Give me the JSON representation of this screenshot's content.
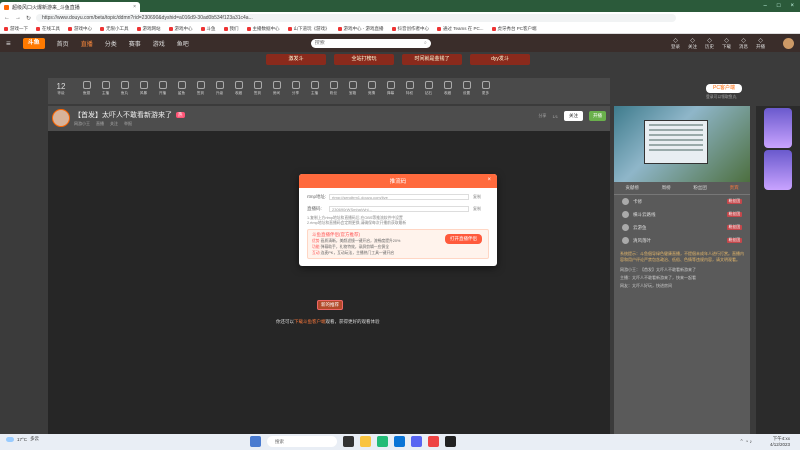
{
  "browser": {
    "tab_title": "超级风口火爆新游来_斗鱼直播",
    "url": "https://www.douyu.com/beta/topic/ddmn?rid=230690&dyshid=a016d9-30ad0b534f123a31c4a..."
  },
  "bookmarks": [
    "游戏一下",
    "在线工具",
    "游戏中心",
    "无限小工具",
    "游戏网站",
    "游戏中心",
    "斗鱼",
    "我们",
    "主播数据中心",
    "山下道玩《游戏》",
    "游戏中心 - 游戏直播",
    "抖音创作者中心",
    "通过 Teams 在 PC...",
    "虎牙秀台 PC客户端"
  ],
  "site": {
    "logo": "斗鱼",
    "nav": [
      "首页",
      "直播",
      "分类",
      "赛事",
      "游戏",
      "鱼吧"
    ],
    "search_placeholder": "搜索",
    "header_icons": [
      "登录",
      "关注",
      "历史",
      "下载",
      "消息",
      "开播"
    ]
  },
  "promos": [
    "激发斗",
    "全站打榜玩",
    "时间就是金钱了",
    "dyy发斗"
  ],
  "toolbar": {
    "level_number": "12",
    "level_label": "等级",
    "tools": [
      "鱼翅",
      "主播",
      "鱼丸",
      "风暴",
      "开播",
      "鲨鱼",
      "签到",
      "升级",
      "收藏",
      "签到",
      "房间",
      "分享",
      "主播",
      "粉丝",
      "宝箱",
      "竞猜",
      "弹幕",
      "特权",
      "钻石",
      "收藏",
      "设置",
      "更多"
    ],
    "pc_button": "PC客户端",
    "login_note": "登录可以领取鱼丸"
  },
  "room": {
    "title": "【首发】太吓人不敢看新游来了",
    "hot_badge": "热",
    "sub": [
      "网游小王",
      "直播",
      "关注",
      "举报"
    ],
    "stats": [
      "分享",
      "1/1"
    ],
    "follow_label": "关注",
    "green_badge": "开播"
  },
  "dialog": {
    "title": "推流码",
    "rtmp_label": "rtmp地址:",
    "rtmp_value": "rtmp://sendtrm1.douyu.com/live",
    "key_label": "直播码:",
    "key_value": "230690rWSmhaVyhl...",
    "copy_label": "复制",
    "tips": [
      "1.复制上方rtmp地址和直播码后,在OBS等推流软件中设置",
      "2.rtmp地址和直播码会定期更换,请确保每次开播前获取最新"
    ],
    "promo_title": "斗鱼直播伴侣(官方推荐)",
    "promo_lines": [
      {
        "tag": "优势",
        "text": "画质清晰，美颜滤镜一键开启，流畅度提升20%"
      },
      {
        "tag": "功能",
        "text": "弹幕助手，礼物特效，录屏剪辑一应俱全"
      },
      {
        "tag": "互动",
        "text": "连麦PK，互动玩法，主播热门工具一键开启"
      }
    ],
    "open_button": "打开直播伴侣",
    "close_icon": "×"
  },
  "bottom": {
    "button": "新的推荐",
    "note_prefix": "你还可以",
    "note_highlight": "下载斗鱼客户端",
    "note_suffix": "观看，获得更好的观看体验"
  },
  "chat": {
    "tabs": [
      "贡献榜",
      "周榜",
      "粉丝团",
      "贵宾"
    ],
    "ranks": [
      {
        "name": "卡修",
        "tag": "粉丝团"
      },
      {
        "name": "横斗云路线",
        "tag": "粉丝团"
      },
      {
        "name": "云游鱼",
        "tag": "粉丝团"
      },
      {
        "name": "清风落叶",
        "tag": "粉丝团"
      }
    ],
    "notice": "系统提示：斗鱼倡导绿色健康直播，不提倡未成年人进行打赏。直播内容和用户评论严禁包含政治、低俗、色情等违规内容，请文明观看。",
    "lines": [
      "网游小王：【首发】太吓人不敢看新游来了",
      "主播：太吓人不敢看新游来了，快来一起看",
      "网友：太吓人好玩，快进房间"
    ]
  },
  "taskbar": {
    "weather_temp": "17°C",
    "weather_desc": "多云",
    "search_label": "搜索",
    "time": "下午4:xx",
    "date": "4/12/2023"
  }
}
